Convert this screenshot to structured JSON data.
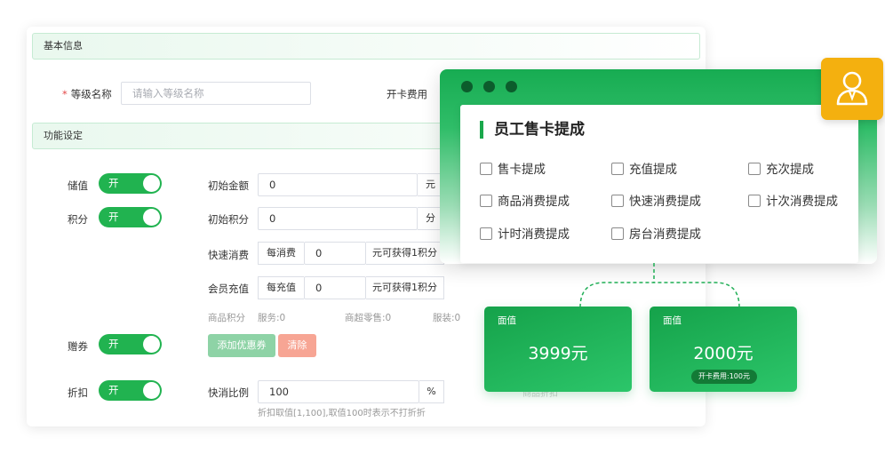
{
  "form": {
    "basic_section": "基本信息",
    "level_name_label": "等级名称",
    "level_name_placeholder": "请输入等级名称",
    "card_fee_label": "开卡费用",
    "function_section": "功能设定",
    "stored_value_label": "储值",
    "points_label": "积分",
    "gift_coupon_label": "赠券",
    "discount_label": "折扣",
    "toggle_on": "开",
    "initial_amount_label": "初始金额",
    "initial_amount_value": "0",
    "initial_amount_unit": "元",
    "initial_points_label": "初始积分",
    "initial_points_value": "0",
    "initial_points_unit": "分",
    "quick_consume_label": "快速消费",
    "quick_consume_prefix": "每消费",
    "quick_consume_value": "0",
    "quick_consume_suffix": "元可获得1积分",
    "member_recharge_label": "会员充值",
    "member_recharge_prefix": "每充值",
    "member_recharge_value": "0",
    "member_recharge_suffix": "元可获得1积分",
    "goods_points_label": "商品积分",
    "service_points": "服务:0",
    "retail_points": "商超零售:0",
    "extra_points": "服装:0",
    "add_coupon_button": "添加优惠券",
    "clear_button": "清除",
    "discount_ratio_label": "快消比例",
    "discount_ratio_value": "100",
    "discount_ratio_unit": "%",
    "discount_hint": "折扣取值[1,100],取值100时表示不打折折",
    "faded_text": "商品折扣"
  },
  "overlay": {
    "title": "员工售卡提成",
    "options": [
      "售卡提成",
      "充值提成",
      "充次提成",
      "商品消费提成",
      "快速消费提成",
      "计次消费提成",
      "计时消费提成",
      "房台消费提成"
    ],
    "icon": "user-avatar-icon"
  },
  "value_cards": [
    {
      "label": "面值",
      "amount": "3999元"
    },
    {
      "label": "面值",
      "amount": "2000元",
      "badge": "开卡费用:100元"
    }
  ],
  "colors": {
    "accent_green": "#21b350",
    "header_green_tint": "#e9f8ee",
    "coupon_button": "#8ed3a6",
    "clear_button": "#f7a594",
    "avatar_bg": "#f4b00f"
  }
}
